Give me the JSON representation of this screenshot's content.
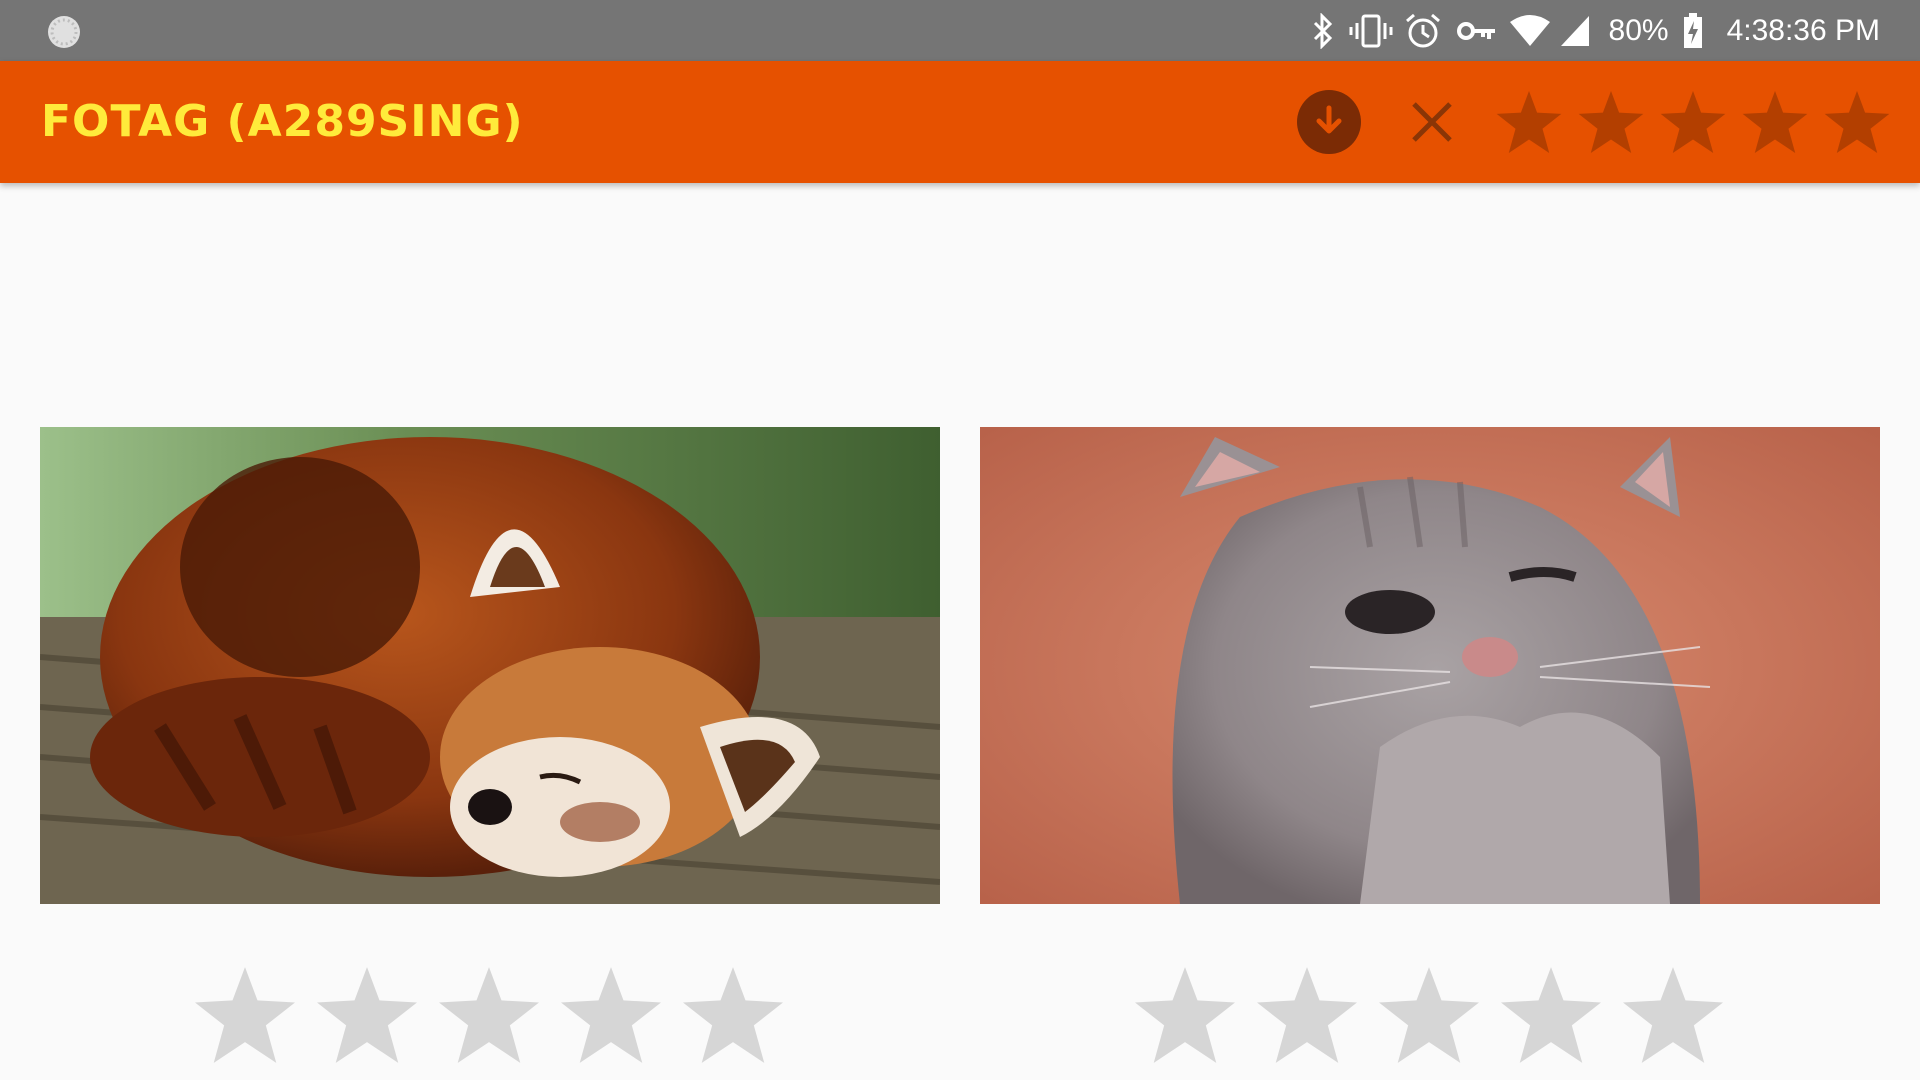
{
  "status_bar": {
    "battery": "80%",
    "time": "4:38:36 PM",
    "icons": [
      "loading-indicator-icon",
      "bluetooth-icon",
      "vibrate-icon",
      "alarm-icon",
      "vpn-key-icon",
      "wifi-icon",
      "cell-signal-icon",
      "battery-charging-icon"
    ]
  },
  "app_bar": {
    "title": "FOTAG (A289SING)",
    "load_icon": "download-circle-icon",
    "clear_icon": "close-icon",
    "filter_stars": [
      1,
      2,
      3,
      4,
      5
    ]
  },
  "gallery": {
    "images": [
      {
        "subject": "sleeping red panda",
        "rating": 0,
        "max_rating": 5
      },
      {
        "subject": "grey kitten",
        "rating": 0,
        "max_rating": 5
      }
    ]
  },
  "colors": {
    "status_bar": "#757575",
    "app_bar": "#e65100",
    "title": "#ffeb3b",
    "filter_star": "#b33f00",
    "rating_star_empty": "#d6d6d6",
    "background": "#fafafa"
  }
}
